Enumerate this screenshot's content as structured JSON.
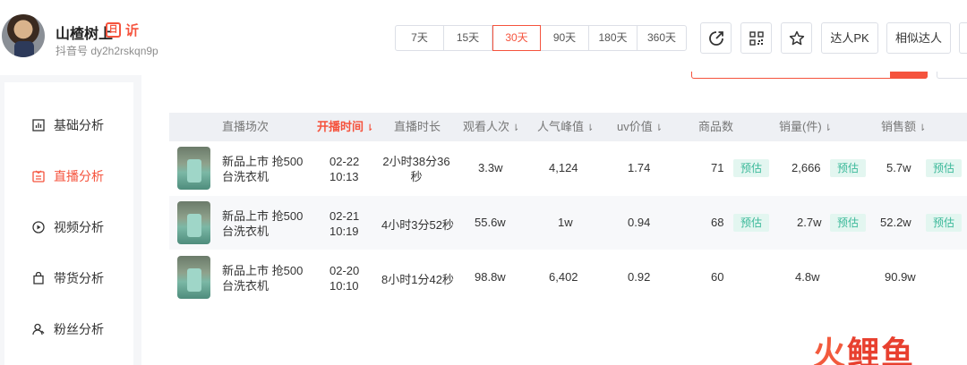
{
  "profile": {
    "name": "山楂树上",
    "badge_text": "日",
    "live_text": "䜣",
    "id_line": "抖音号 dy2h2rskqn9p"
  },
  "time_ranges": [
    {
      "label": "7天",
      "active": false
    },
    {
      "label": "15天",
      "active": false
    },
    {
      "label": "30天",
      "active": true
    },
    {
      "label": "90天",
      "active": false
    },
    {
      "label": "180天",
      "active": false
    },
    {
      "label": "360天",
      "active": false
    }
  ],
  "header_actions": {
    "share_icon": "share-icon",
    "qr_icon": "qr-code-icon",
    "favorite_icon": "star-icon",
    "pk_label": "达人PK",
    "similar_label": "相似达人"
  },
  "sidebar": {
    "items": [
      {
        "label": "基础分析",
        "icon": "bar-chart-icon",
        "active": false
      },
      {
        "label": "直播分析",
        "icon": "live-icon",
        "active": true
      },
      {
        "label": "视频分析",
        "icon": "play-icon",
        "active": false
      },
      {
        "label": "带货分析",
        "icon": "shopping-bag-icon",
        "active": false
      },
      {
        "label": "粉丝分析",
        "icon": "fans-icon",
        "active": false
      }
    ]
  },
  "table": {
    "headers": {
      "session": "直播场次",
      "start_time": "开播时间",
      "duration": "直播时长",
      "views": "观看人次",
      "peak": "人气峰值",
      "uv": "uv价值",
      "products": "商品数",
      "sales_qty": "销量(件)",
      "sales_amt": "销售额"
    },
    "estimate_label": "预估",
    "rows": [
      {
        "title": "新品上市 抢500台洗衣机",
        "date": "02-22",
        "time": "10:13",
        "duration": "2小时38分36秒",
        "views": "3.3w",
        "peak": "4,124",
        "uv": "1.74",
        "products": "71",
        "sales_qty": "2,666",
        "sales_amt": "5.7w",
        "estimated": true
      },
      {
        "title": "新品上市 抢500台洗衣机",
        "date": "02-21",
        "time": "10:19",
        "duration": "4小时3分52秒",
        "views": "55.6w",
        "peak": "1w",
        "uv": "0.94",
        "products": "68",
        "sales_qty": "2.7w",
        "sales_amt": "52.2w",
        "estimated": true
      },
      {
        "title": "新品上市 抢500台洗衣机",
        "date": "02-20",
        "time": "10:10",
        "duration": "8小时1分42秒",
        "views": "98.8w",
        "peak": "6,402",
        "uv": "0.92",
        "products": "60",
        "sales_qty": "4.8w",
        "sales_amt": "90.9w",
        "estimated": false
      }
    ]
  },
  "watermark": {
    "part1": "火",
    "part2": "鲤",
    "part3": "鱼"
  },
  "colors": {
    "accent": "#f5533d",
    "estimate_tag": "#3cb99a",
    "estimate_tag_bg": "#e3f6f0",
    "header_bg": "#eef0f4"
  }
}
